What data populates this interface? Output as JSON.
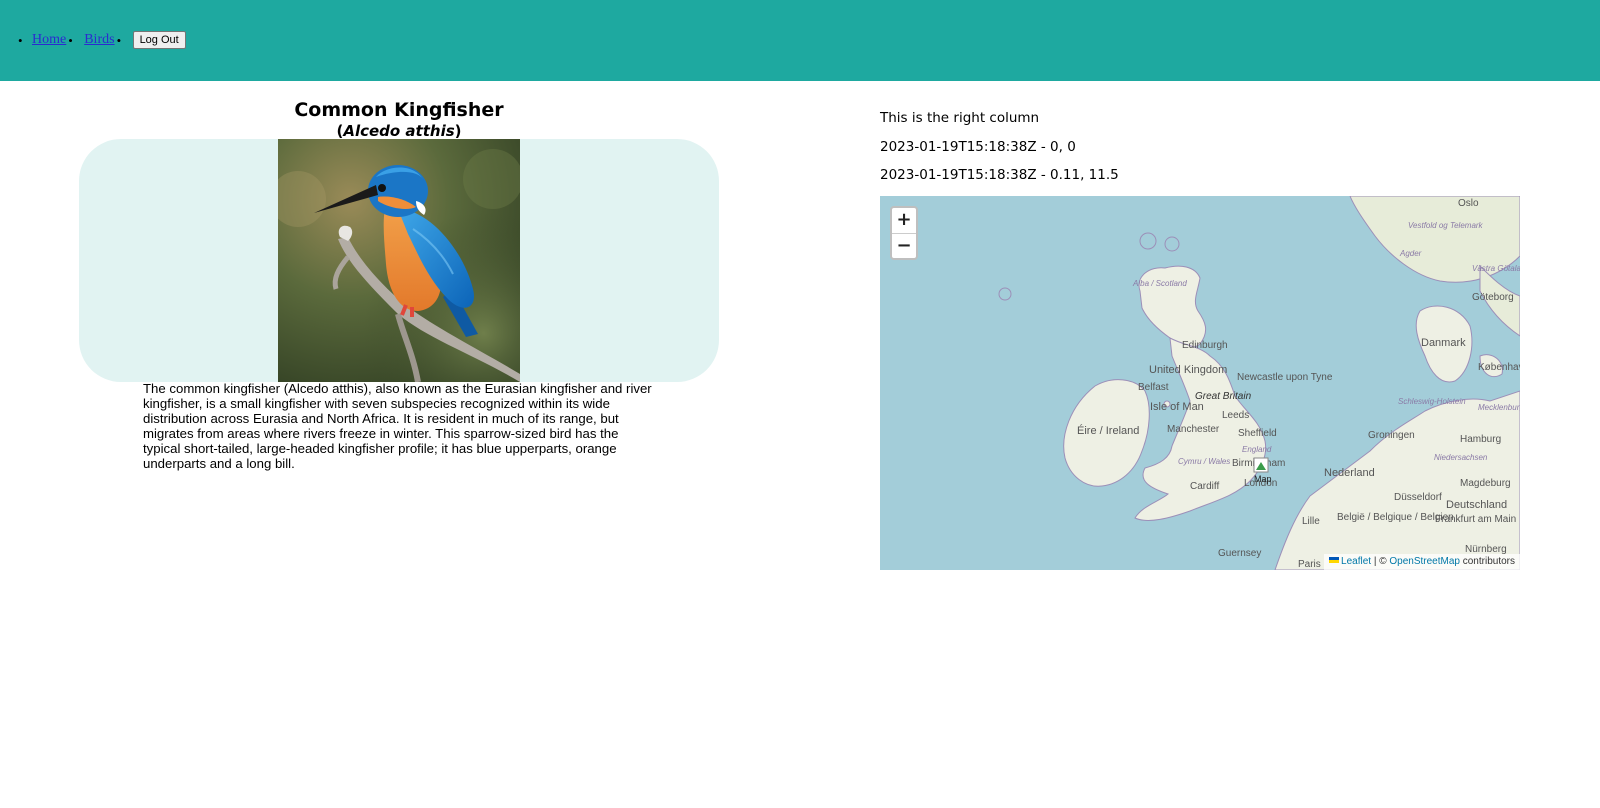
{
  "nav": {
    "items": [
      {
        "label": "Home"
      },
      {
        "label": "Birds"
      }
    ],
    "logout_label": "Log Out"
  },
  "bird": {
    "common_name": "Common Kingfisher",
    "scientific_name": "Alcedo atthis",
    "description": "The common kingfisher (Alcedo atthis), also known as the Eurasian kingfisher and river kingfisher, is a small kingfisher with seven subspecies recognized within its wide distribution across Eurasia and North Africa. It is resident in much of its range, but migrates from areas where rivers freeze in winter. This sparrow-sized bird has the typical short-tailed, large-headed kingfisher profile; it has blue upperparts, orange underparts and a long bill."
  },
  "right_column": {
    "heading": "This is the right column",
    "readings": [
      "2023-01-19T15:18:38Z - 0, 0",
      "2023-01-19T15:18:38Z - 0.11, 11.5"
    ]
  },
  "map": {
    "zoom_in": "+",
    "zoom_out": "−",
    "attribution": {
      "leaflet": "Leaflet",
      "separator": " | © ",
      "osm": "OpenStreetMap",
      "suffix": " contributors"
    },
    "marker_label": "Map",
    "labels": [
      "Oslo",
      "Vestfold og Telemark",
      "Agder",
      "Västra Götaland",
      "Göteborg",
      "Alba / Scotland",
      "Edinburgh",
      "United Kingdom",
      "Belfast",
      "Newcastle upon Tyne",
      "Great Britain",
      "Isle of Man",
      "Leeds",
      "Éire / Ireland",
      "Manchester",
      "Sheffield",
      "England",
      "Cymru / Wales",
      "Birmingham",
      "London",
      "Cardiff",
      "Danmark",
      "København",
      "Schleswig-Holstein",
      "Mecklenburg-Vorpommern",
      "Groningen",
      "Hamburg",
      "Niedersachsen",
      "Nederland",
      "Magdeburg",
      "Düsseldorf",
      "Deutschland",
      "België / Belgique / Belgien",
      "Lille",
      "Frankfurt am Main",
      "Nürnberg",
      "Guernsey",
      "Paris"
    ]
  },
  "colors": {
    "header": "#1ea9a0",
    "photo_panel": "#e1f3f2",
    "sea": "#a3cdd9",
    "land": "#eef0e4"
  }
}
